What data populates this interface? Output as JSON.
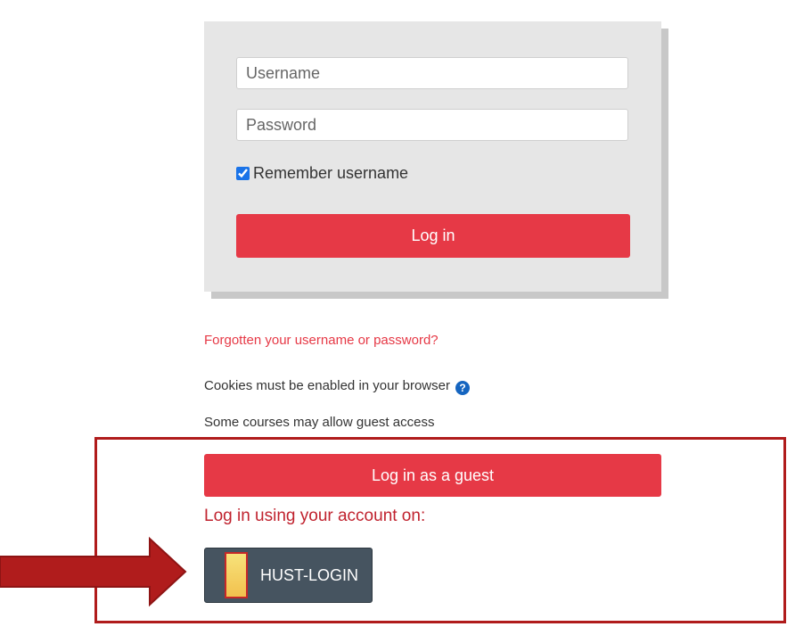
{
  "login_form": {
    "username_placeholder": "Username",
    "password_placeholder": "Password",
    "remember_label": "Remember username",
    "remember_checked": true,
    "login_button": "Log in"
  },
  "links": {
    "forgot": "Forgotten your username or password?"
  },
  "info": {
    "cookies_text": "Cookies must be enabled in your browser",
    "guest_access_text": "Some courses may allow guest access"
  },
  "guest": {
    "button_label": "Log in as a guest"
  },
  "sso": {
    "heading": "Log in using your account on:",
    "provider_label": "HUST-LOGIN",
    "provider_logo_icon": "hust-logo-icon"
  },
  "colors": {
    "accent": "#e63946",
    "sso_button": "#465460",
    "annotation": "#b01c1c"
  }
}
